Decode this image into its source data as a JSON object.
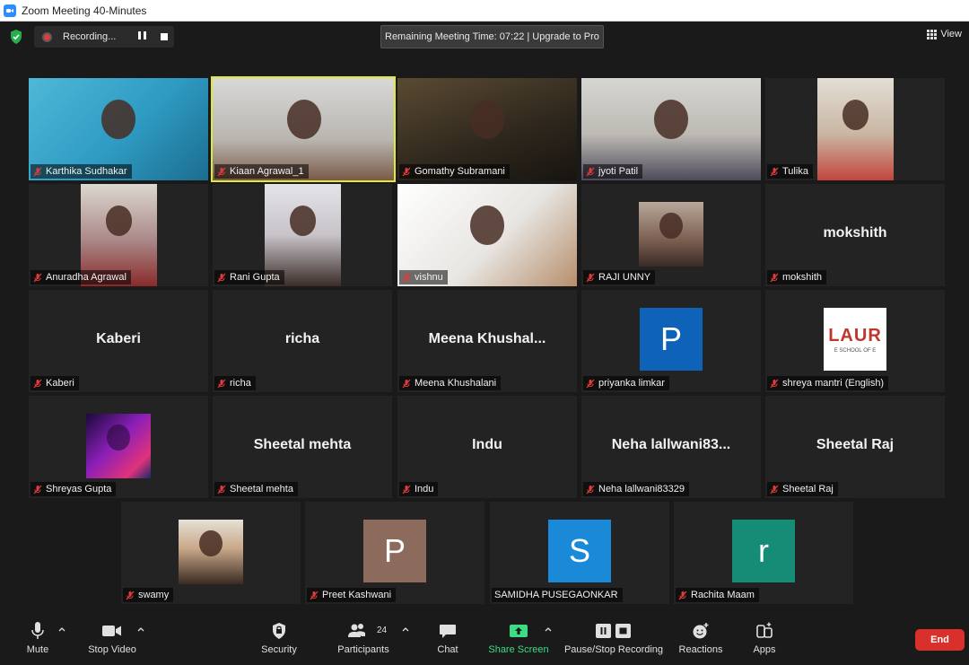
{
  "window": {
    "title": "Zoom Meeting 40-Minutes"
  },
  "topbar": {
    "recording_label": "Recording...",
    "remaining": "Remaining Meeting Time: 07:22 | Upgrade to Pro",
    "view_label": "View"
  },
  "participants": [
    {
      "name": "Karthika Sudhakar"
    },
    {
      "name": "Kiaan Agrawal_1"
    },
    {
      "name": "Gomathy Subramani"
    },
    {
      "name": "jyoti Patil"
    },
    {
      "name": "Tulika"
    },
    {
      "name": "Anuradha Agrawal"
    },
    {
      "name": "Rani Gupta"
    },
    {
      "name": "vishnu"
    },
    {
      "name": "RAJI UNNY"
    },
    {
      "name": "mokshith",
      "display": "mokshith"
    },
    {
      "name": "Kaberi",
      "display": "Kaberi"
    },
    {
      "name": "richa",
      "display": "richa"
    },
    {
      "name": "Meena Khushalani",
      "display": "Meena  Khushal..."
    },
    {
      "name": "priyanka limkar",
      "avatar_letter": "P",
      "avatar_color": "#0e63b8"
    },
    {
      "name": "shreya mantri (English)",
      "avatar_text": "LAUR",
      "avatar_subtext": "E SCHOOL OF E"
    },
    {
      "name": "Shreyas Gupta"
    },
    {
      "name": "Sheetal mehta",
      "display": "Sheetal mehta"
    },
    {
      "name": "Indu",
      "display": "Indu"
    },
    {
      "name": "Neha lallwani83329",
      "display": "Neha  lallwani83..."
    },
    {
      "name": "Sheetal Raj",
      "display": "Sheetal Raj"
    },
    {
      "name": "swamy"
    },
    {
      "name": "Preet Kashwani",
      "avatar_letter": "P",
      "avatar_color": "#8c6a5c"
    },
    {
      "name": "SAMIDHA PUSEGAONKAR",
      "avatar_letter": "S",
      "avatar_color": "#1a8ad8"
    },
    {
      "name": "Rachita Maam",
      "avatar_letter": "r",
      "avatar_color": "#158c76"
    }
  ],
  "toolbar": {
    "mute": "Mute",
    "stop_video": "Stop Video",
    "security": "Security",
    "participants": "Participants",
    "participants_count": "24",
    "chat": "Chat",
    "share_screen": "Share Screen",
    "pause_stop_recording": "Pause/Stop Recording",
    "reactions": "Reactions",
    "apps": "Apps",
    "end": "End"
  },
  "colors": {
    "background": "#1a1a1a",
    "tile": "#232323",
    "active_speaker_border": "#e0e83a",
    "share_green": "#3ddc84",
    "end_red": "#d9302b",
    "muted_red": "#e23b3b"
  }
}
